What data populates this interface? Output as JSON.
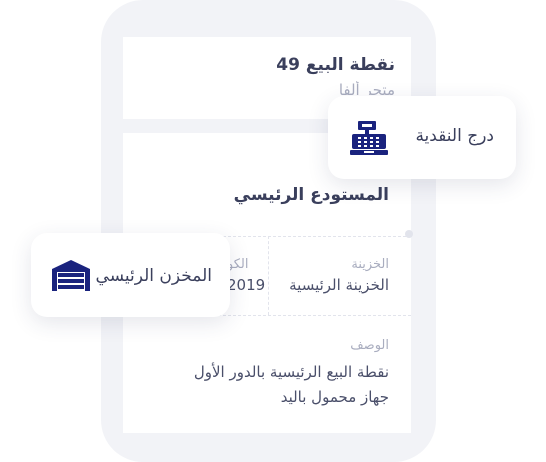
{
  "pos_card": {
    "title": "نقطة البيع 49",
    "subtitle": "متجر ألفا"
  },
  "store_card": {
    "name": "المستودع الرئيسي",
    "treasury_label": "الخزينة",
    "treasury_value": "الخزينة الرئيسية",
    "code_label": "الكو",
    "code_value": "2019",
    "description_label": "الوصف",
    "description_line1": "نقطة البيع الرئيسية بالدور الأول",
    "description_line2": "جهاز محمول باليد"
  },
  "float_cash_drawer": {
    "label": "درج النقدية",
    "icon": "cash-register-icon"
  },
  "float_main_store": {
    "label": "المخزن الرئيسي",
    "icon": "warehouse-icon"
  },
  "colors": {
    "accent": "#1a237e",
    "text_dark": "#3a3f5c",
    "text_muted": "#a9adbf",
    "phone_bg": "#f2f3f7"
  }
}
